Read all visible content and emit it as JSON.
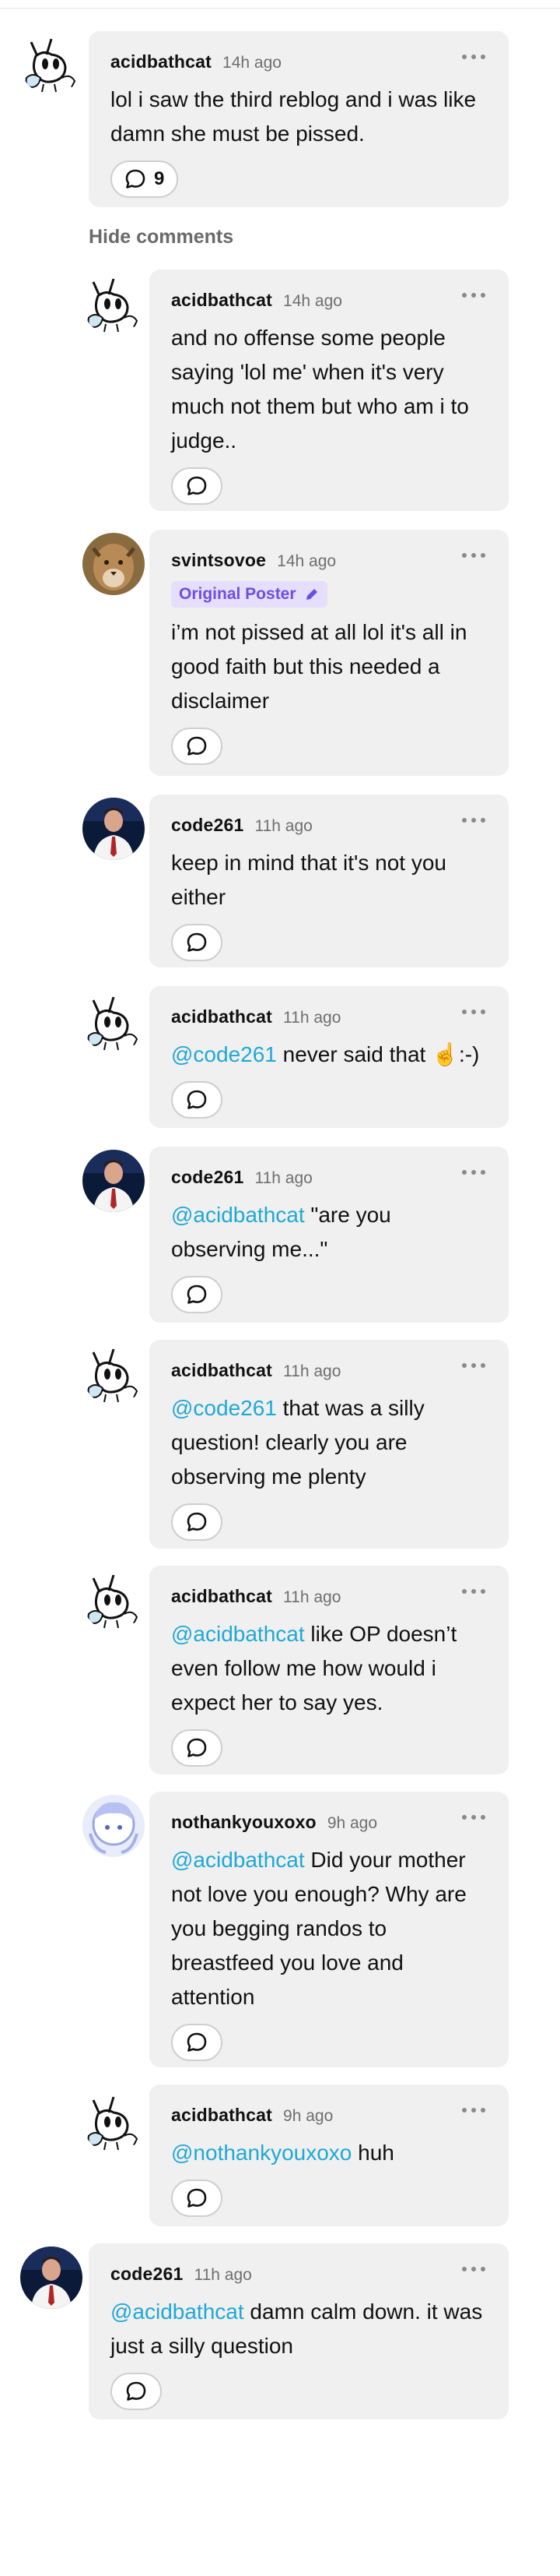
{
  "hide_comments_label": "Hide comments",
  "colors": {
    "mention": "#20a8d8",
    "badge_bg": "#e6defd",
    "badge_text": "#6e4fe0",
    "bubble_bg": "#f0f0f0"
  },
  "comments": [
    {
      "user": "acidbathcat",
      "time": "14h ago",
      "text": "lol i saw the third reblog and i was like damn she must be pissed.",
      "reply_count": "9",
      "avatar": "cat-doodle-avatar"
    },
    {
      "user": "acidbathcat",
      "time": "14h ago",
      "text": "and no offense some people saying 'lol me' when it's very much not them but who am i to judge..",
      "avatar": "cat-doodle-avatar"
    },
    {
      "user": "svintsovoe",
      "time": "14h ago",
      "badge": "Original Poster",
      "text": "i’m not pissed at all lol it's all in good faith but this needed a disclaimer",
      "avatar": "cougar-avatar"
    },
    {
      "user": "code261",
      "time": "11h ago",
      "text": "keep in mind that it's not you either",
      "avatar": "man-portrait-avatar"
    },
    {
      "user": "acidbathcat",
      "time": "11h ago",
      "mention": "@code261",
      "text": " never said that ☝:-)",
      "avatar": "cat-doodle-avatar"
    },
    {
      "user": "code261",
      "time": "11h ago",
      "mention": "@acidbathcat",
      "text": " \"are you observing me...\"",
      "avatar": "man-portrait-avatar"
    },
    {
      "user": "acidbathcat",
      "time": "11h ago",
      "mention": "@code261",
      "text": " that was a silly question! clearly you are observing me plenty",
      "avatar": "cat-doodle-avatar"
    },
    {
      "user": "acidbathcat",
      "time": "11h ago",
      "mention": "@acidbathcat",
      "text": " like OP doesn’t even follow me how would i expect her to say yes.",
      "avatar": "cat-doodle-avatar"
    },
    {
      "user": "nothankyouxoxo",
      "time": "9h ago",
      "mention": "@acidbathcat",
      "text": " Did your mother not love you enough? Why are you begging randos to breastfeed you love and attention",
      "avatar": "anime-avatar"
    },
    {
      "user": "acidbathcat",
      "time": "9h ago",
      "mention": "@nothankyouxoxo",
      "text": " huh",
      "avatar": "cat-doodle-avatar"
    },
    {
      "user": "code261",
      "time": "11h ago",
      "mention": "@acidbathcat",
      "text": " damn calm down. it was just a silly question",
      "avatar": "man-portrait-avatar"
    }
  ]
}
